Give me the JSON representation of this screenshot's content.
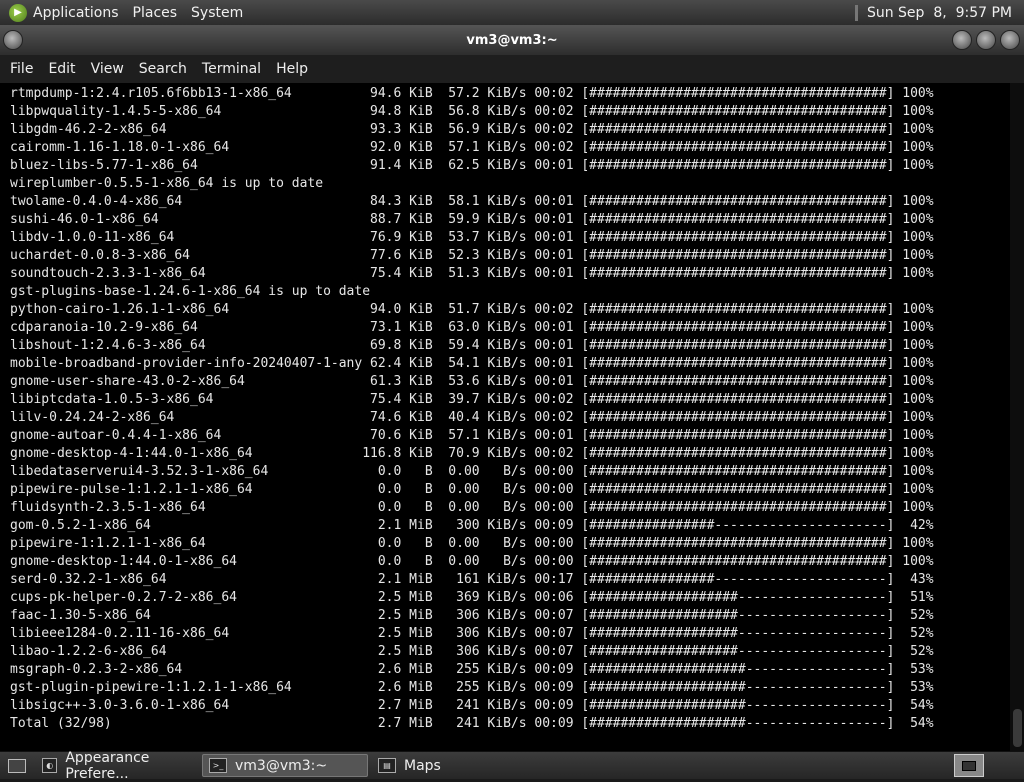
{
  "top_panel": {
    "menus": [
      "Applications",
      "Places",
      "System"
    ],
    "clock": "Sun Sep  8,  9:57 PM"
  },
  "window": {
    "title": "vm3@vm3:~",
    "menus": [
      "File",
      "Edit",
      "View",
      "Search",
      "Terminal",
      "Help"
    ]
  },
  "terminal": {
    "lines": [
      "rtmpdump-1:2.4.r105.6f6bb13-1-x86_64          94.6 KiB  57.2 KiB/s 00:02 [######################################] 100%",
      "libpwquality-1.4.5-5-x86_64                   94.8 KiB  56.8 KiB/s 00:02 [######################################] 100%",
      "libgdm-46.2-2-x86_64                          93.3 KiB  56.9 KiB/s 00:02 [######################################] 100%",
      "cairomm-1.16-1.18.0-1-x86_64                  92.0 KiB  57.1 KiB/s 00:02 [######################################] 100%",
      "bluez-libs-5.77-1-x86_64                      91.4 KiB  62.5 KiB/s 00:01 [######################################] 100%",
      "wireplumber-0.5.5-1-x86_64 is up to date",
      "twolame-0.4.0-4-x86_64                        84.3 KiB  58.1 KiB/s 00:01 [######################################] 100%",
      "sushi-46.0-1-x86_64                           88.7 KiB  59.9 KiB/s 00:01 [######################################] 100%",
      "libdv-1.0.0-11-x86_64                         76.9 KiB  53.7 KiB/s 00:01 [######################################] 100%",
      "uchardet-0.0.8-3-x86_64                       77.6 KiB  52.3 KiB/s 00:01 [######################################] 100%",
      "soundtouch-2.3.3-1-x86_64                     75.4 KiB  51.3 KiB/s 00:01 [######################################] 100%",
      "gst-plugins-base-1.24.6-1-x86_64 is up to date",
      "python-cairo-1.26.1-1-x86_64                  94.0 KiB  51.7 KiB/s 00:02 [######################################] 100%",
      "cdparanoia-10.2-9-x86_64                      73.1 KiB  63.0 KiB/s 00:01 [######################################] 100%",
      "libshout-1:2.4.6-3-x86_64                     69.8 KiB  59.4 KiB/s 00:01 [######################################] 100%",
      "mobile-broadband-provider-info-20240407-1-any 62.4 KiB  54.1 KiB/s 00:01 [######################################] 100%",
      "gnome-user-share-43.0-2-x86_64                61.3 KiB  53.6 KiB/s 00:01 [######################################] 100%",
      "libiptcdata-1.0.5-3-x86_64                    75.4 KiB  39.7 KiB/s 00:02 [######################################] 100%",
      "lilv-0.24.24-2-x86_64                         74.6 KiB  40.4 KiB/s 00:02 [######################################] 100%",
      "gnome-autoar-0.4.4-1-x86_64                   70.6 KiB  57.1 KiB/s 00:01 [######################################] 100%",
      "gnome-desktop-4-1:44.0-1-x86_64              116.8 KiB  70.9 KiB/s 00:02 [######################################] 100%",
      "libedataserverui4-3.52.3-1-x86_64              0.0   B  0.00   B/s 00:00 [######################################] 100%",
      "pipewire-pulse-1:1.2.1-1-x86_64                0.0   B  0.00   B/s 00:00 [######################################] 100%",
      "fluidsynth-2.3.5-1-x86_64                      0.0   B  0.00   B/s 00:00 [######################################] 100%",
      "gom-0.5.2-1-x86_64                             2.1 MiB   300 KiB/s 00:09 [################----------------------]  42%",
      "pipewire-1:1.2.1-1-x86_64                      0.0   B  0.00   B/s 00:00 [######################################] 100%",
      "gnome-desktop-1:44.0-1-x86_64                  0.0   B  0.00   B/s 00:00 [######################################] 100%",
      "serd-0.32.2-1-x86_64                           2.1 MiB   161 KiB/s 00:17 [################----------------------]  43%",
      "cups-pk-helper-0.2.7-2-x86_64                  2.5 MiB   369 KiB/s 00:06 [###################-------------------]  51%",
      "faac-1.30-5-x86_64                             2.5 MiB   306 KiB/s 00:07 [###################-------------------]  52%",
      "libieee1284-0.2.11-16-x86_64                   2.5 MiB   306 KiB/s 00:07 [###################-------------------]  52%",
      "libao-1.2.2-6-x86_64                           2.5 MiB   306 KiB/s 00:07 [###################-------------------]  52%",
      "msgraph-0.2.3-2-x86_64                         2.6 MiB   255 KiB/s 00:09 [####################------------------]  53%",
      "gst-plugin-pipewire-1:1.2.1-1-x86_64           2.6 MiB   255 KiB/s 00:09 [####################------------------]  53%",
      "libsigc++-3.0-3.6.0-1-x86_64                   2.7 MiB   241 KiB/s 00:09 [####################------------------]  54%",
      "Total (32/98)                                  2.7 MiB   241 KiB/s 00:09 [####################------------------]  54%"
    ]
  },
  "taskbar": {
    "tasks": [
      "Appearance Prefere...",
      "vm3@vm3:~",
      "Maps"
    ],
    "active_index": 1
  }
}
